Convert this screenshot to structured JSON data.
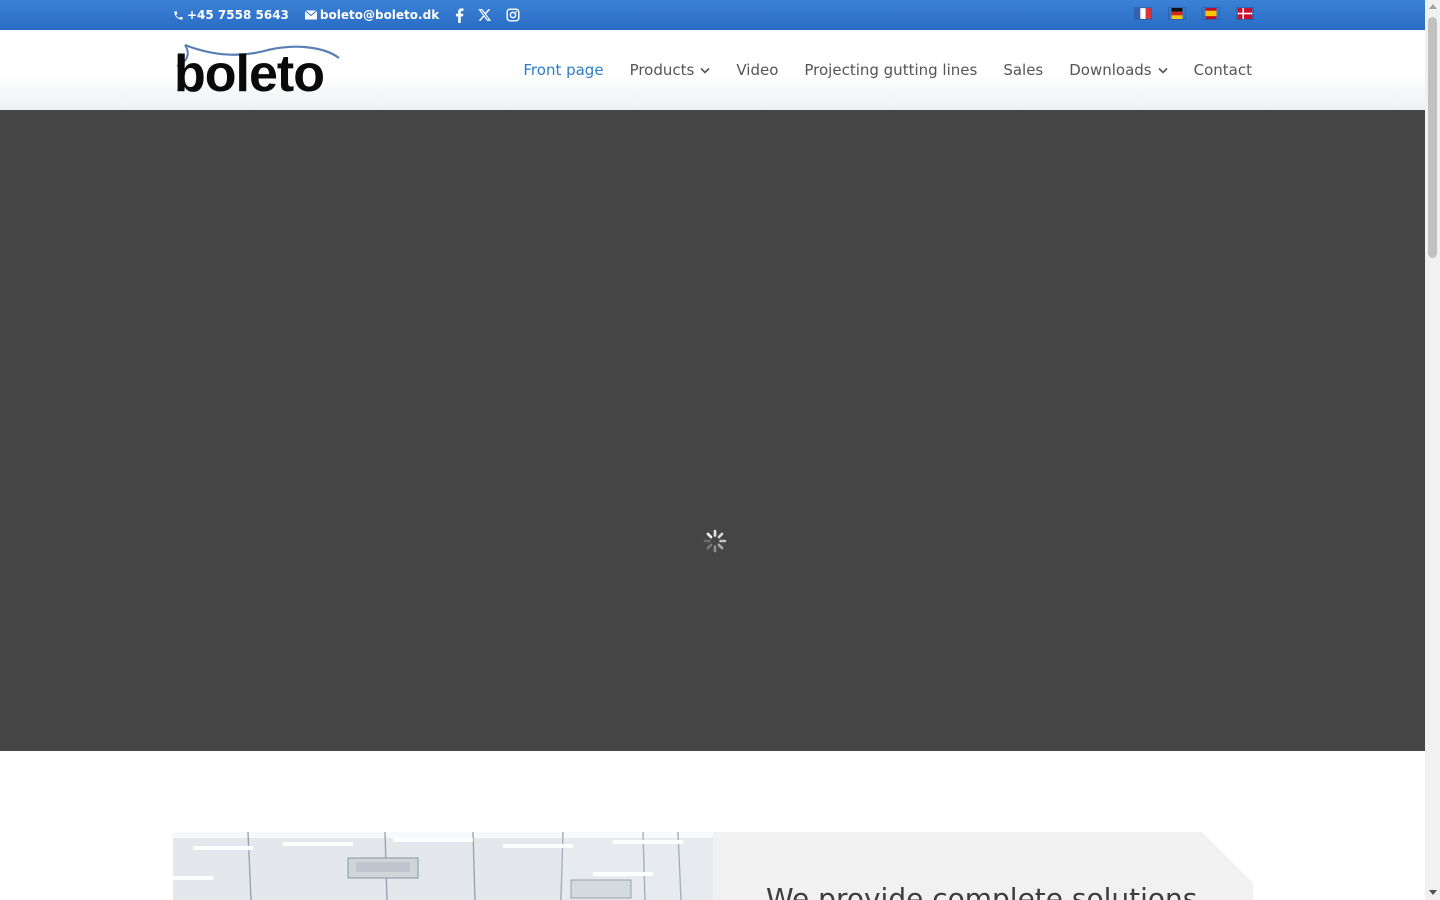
{
  "topbar": {
    "phone": "+45 7558 5643",
    "email": "boleto@boleto.dk",
    "social": [
      "facebook-icon",
      "x-icon",
      "instagram-icon"
    ],
    "languages": [
      "French",
      "German",
      "Spanish",
      "Danish"
    ]
  },
  "header": {
    "logo_text": "boleto",
    "nav": [
      {
        "label": "Front page",
        "active": true,
        "has_submenu": false
      },
      {
        "label": "Products",
        "active": false,
        "has_submenu": true
      },
      {
        "label": "Video",
        "active": false,
        "has_submenu": false
      },
      {
        "label": "Projecting gutting lines",
        "active": false,
        "has_submenu": false
      },
      {
        "label": "Sales",
        "active": false,
        "has_submenu": false
      },
      {
        "label": "Downloads",
        "active": false,
        "has_submenu": true
      },
      {
        "label": "Contact",
        "active": false,
        "has_submenu": false
      }
    ]
  },
  "hero": {
    "state": "loading"
  },
  "feature": {
    "title": "We provide complete solutions"
  },
  "colors": {
    "topbar": "#2a6cc4",
    "accent": "#2e7cc7",
    "hero_bg": "#454545",
    "feature_bg": "#f1f1f1"
  }
}
